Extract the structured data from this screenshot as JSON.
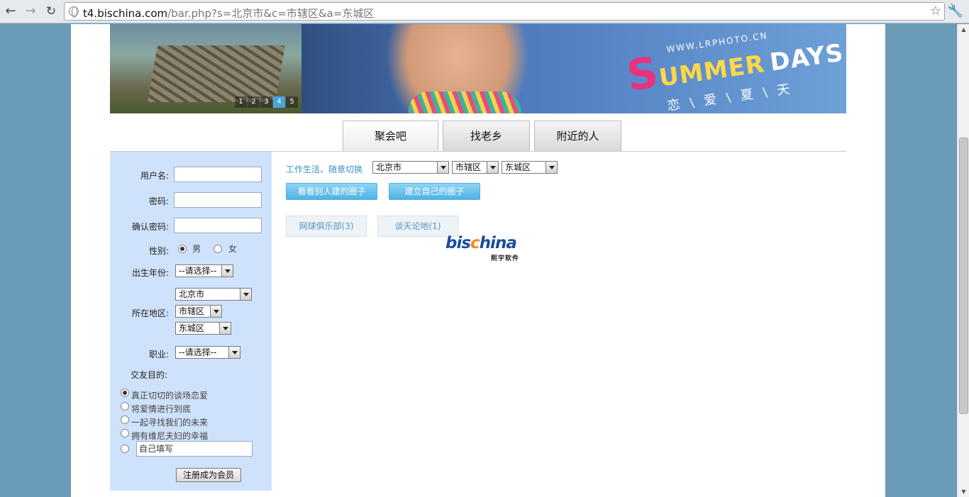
{
  "browser": {
    "url_host": "t4.bischina.com",
    "url_path": "/bar.php?s=北京市&c=市辖区&a=东城区"
  },
  "banner": {
    "summer_url": "WWW.LRPHOTO.CN",
    "summer_s": "S",
    "summer_rest": "UMMER",
    "summer_days": "DAYS",
    "summer_cn": "恋\\爱\\夏\\天",
    "slides": [
      "1",
      "2",
      "3",
      "4",
      "5"
    ],
    "active_slide": 3
  },
  "tabs": [
    {
      "label": "聚会吧",
      "active": true
    },
    {
      "label": "找老乡",
      "active": false
    },
    {
      "label": "附近的人",
      "active": false
    }
  ],
  "register": {
    "username_label": "用户名:",
    "password_label": "密码:",
    "confirm_label": "确认密码:",
    "gender_label": "性别:",
    "gender_male": "男",
    "gender_female": "女",
    "birth_label": "出生年份:",
    "birth_value": "--请选择--",
    "region_label": "所在地区:",
    "province": "北京市",
    "city": "市辖区",
    "district": "东城区",
    "job_label": "职业:",
    "job_value": "--请选择--",
    "purpose_label": "交友目的:",
    "purposes": [
      "真正切切的谈场恋爱",
      "将爱情进行到底",
      "一起寻找我们的未来",
      "拥有维尼夫妇的幸福"
    ],
    "custom_placeholder": "自己填写",
    "submit_label": "注册成为会员"
  },
  "main": {
    "switch_label": "工作生活、随意切换",
    "province": "北京市",
    "city": "市辖区",
    "district": "东城区",
    "view_others_btn": "看看别人建的圈子",
    "create_btn": "建立自己的圈子",
    "circles": [
      "网球俱乐部(3)",
      "谈天论地(1)"
    ]
  },
  "logo": {
    "main_a": "bis",
    "main_b": "c",
    "main_c": "hina",
    "sub": "熙宇软件"
  }
}
